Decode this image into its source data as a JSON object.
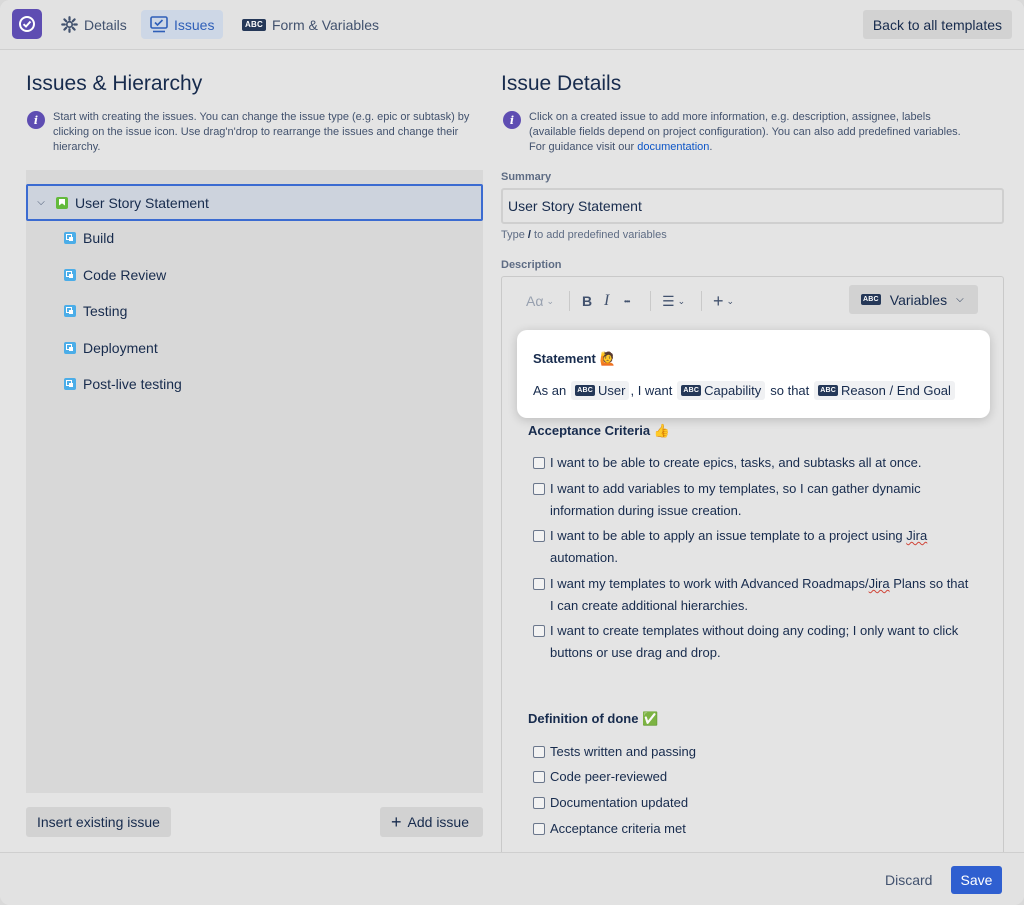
{
  "header": {
    "tabs": [
      {
        "label": "Details"
      },
      {
        "label": "Issues"
      },
      {
        "label": "Form & Variables"
      }
    ],
    "abc_icon": "ABC",
    "back_label": "Back to all templates"
  },
  "left": {
    "title": "Issues & Hierarchy",
    "info": "Start with creating the issues. You can change the issue type (e.g. epic or subtask) by clicking on the issue icon. Use drag'n'drop to rearrange the issues and change their hierarchy.",
    "root": {
      "label": "User Story Statement"
    },
    "children": [
      {
        "label": "Build"
      },
      {
        "label": "Code Review"
      },
      {
        "label": "Testing"
      },
      {
        "label": "Deployment"
      },
      {
        "label": "Post-live testing"
      }
    ],
    "insert_label": "Insert existing issue",
    "add_label": "Add issue"
  },
  "right": {
    "title": "Issue Details",
    "info_text": "Click on a created issue to add more information, e.g. description, assignee, labels (available fields depend on project configuration). You can also add predefined variables. For guidance visit our ",
    "info_link": "documentation",
    "info_end": ".",
    "summary_label": "Summary",
    "summary_value": "User Story Statement",
    "hint_prefix": "Type ",
    "hint_key": "/",
    "hint_suffix": " to add predefined variables",
    "description_label": "Description",
    "toolbar": {
      "text_style": "Aα",
      "bold": "B",
      "italic": "I",
      "more": "•••",
      "list": "☰",
      "insert": "+",
      "variables_label": "Variables"
    },
    "statement": {
      "title": "Statement 🙋",
      "as_an": "As an",
      "var1": "User",
      "i_want": ", I want",
      "var2": "Capability",
      "so_that": "so that",
      "var3": "Reason / End Goal"
    },
    "acceptance": {
      "title": "Acceptance Criteria 👍",
      "items": [
        {
          "line1": "I want to be able to create epics, tasks, and subtasks all at once.",
          "line2": ""
        },
        {
          "line1": "I want to add variables to my templates, so I can gather dynamic",
          "line2": "information during issue creation."
        },
        {
          "line1": "I want to be able to apply an issue template to a project using ",
          "jira": "Jira",
          "line2": "automation."
        },
        {
          "line1a": "I want my templates to work with Advanced Roadmaps/",
          "jira": "Jira",
          "line1b": " Plans so that",
          "line2": "I can create additional hierarchies."
        },
        {
          "line1": "I want to create templates without doing any coding; I only want to click",
          "line2": "buttons or use drag and drop."
        }
      ]
    },
    "done": {
      "title": "Definition of done ✅",
      "items": [
        {
          "label": "Tests written and passing"
        },
        {
          "label": "Code peer-reviewed"
        },
        {
          "label": "Documentation updated"
        },
        {
          "label": "Acceptance criteria met"
        }
      ]
    }
  },
  "footer": {
    "discard_label": "Discard",
    "save_label": "Save"
  },
  "colors": {
    "brand": "#5e4db2",
    "accent": "#2f5fd0",
    "active_tab": "#cdd7e6",
    "story": "#63ba3c",
    "subtask": "#4bade8"
  }
}
